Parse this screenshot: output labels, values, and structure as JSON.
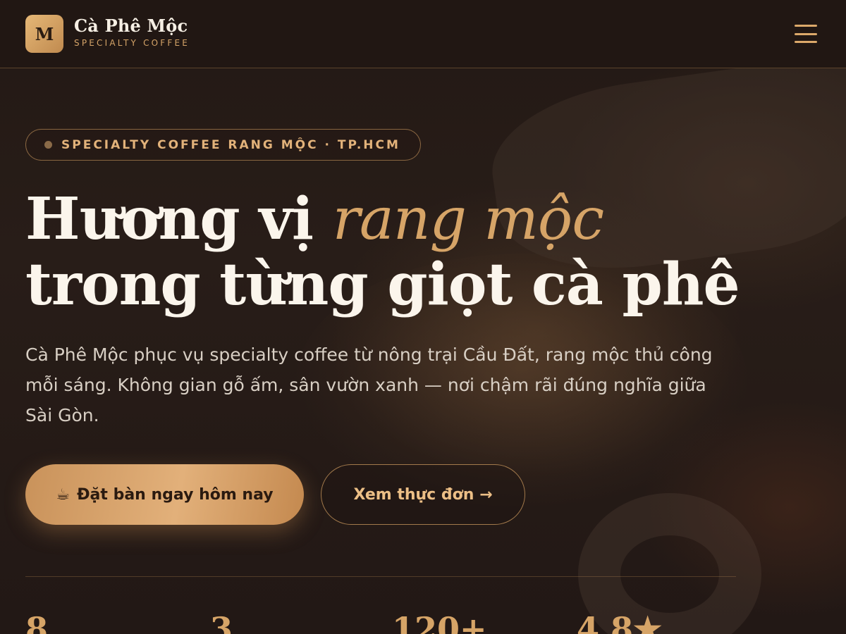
{
  "header": {
    "logo_letter": "M",
    "brand_name": "Cà Phê Mộc",
    "brand_tagline": "SPECIALTY COFFEE",
    "menu_icon": "hamburger-menu-icon"
  },
  "hero": {
    "badge_text": "SPECIALTY COFFEE RANG MỘC · TP.HCM",
    "headline_part1": "Hương vị ",
    "headline_accent": "rang mộc",
    "headline_line2": "trong từng giọt cà phê",
    "description": "Cà Phê Mộc phục vụ specialty coffee từ nông trại Cầu Đất, rang mộc thủ công mỗi sáng. Không gian gỗ ấm, sân vườn xanh — nơi chậm rãi đúng nghĩa giữa Sài Gòn.",
    "primary_button": {
      "icon": "☕",
      "label": "Đặt bàn ngay hôm nay"
    },
    "secondary_button": {
      "label": "Xem thực đơn →"
    }
  },
  "stats": [
    {
      "value": "8"
    },
    {
      "value": "3"
    },
    {
      "value": "120+"
    },
    {
      "value": "4.8★"
    }
  ],
  "colors": {
    "accent": "#d6a467",
    "background": "#221814",
    "text": "#fbf5ec"
  }
}
